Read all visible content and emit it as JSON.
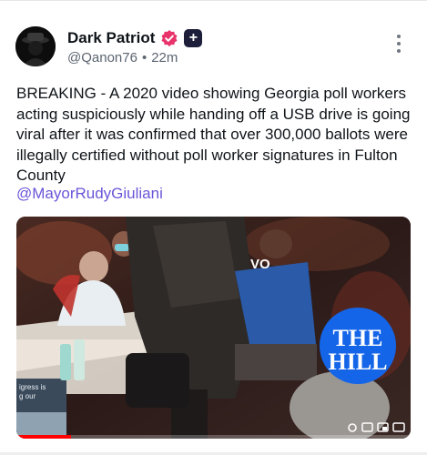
{
  "post": {
    "display_name": "Dark Patriot",
    "handle": "@Qanon76",
    "separator": "•",
    "time": "22m",
    "text": "BREAKING - A 2020 video showing Georgia poll workers acting suspiciously while handing off a USB drive is going viral after it was confirmed that over 300,000 ballots were illegally certified without poll worker signatures in Fulton County",
    "mention": "@MayorRudyGiuliani",
    "badge_plus": "+"
  },
  "video": {
    "logo_line1": "THE",
    "logo_line2": "HILL",
    "shirt_text": "VO",
    "screen_text_1": "igress is",
    "screen_text_2": "g our"
  },
  "colors": {
    "verified": "#e8336b",
    "mention": "#6b55d8",
    "hill_blue": "#1565e8"
  },
  "icons": [
    "avatar-image",
    "verified-badge-icon",
    "plus-badge-icon",
    "more-options-icon",
    "settings-icon",
    "captions-icon",
    "miniplayer-icon",
    "cast-icon"
  ]
}
